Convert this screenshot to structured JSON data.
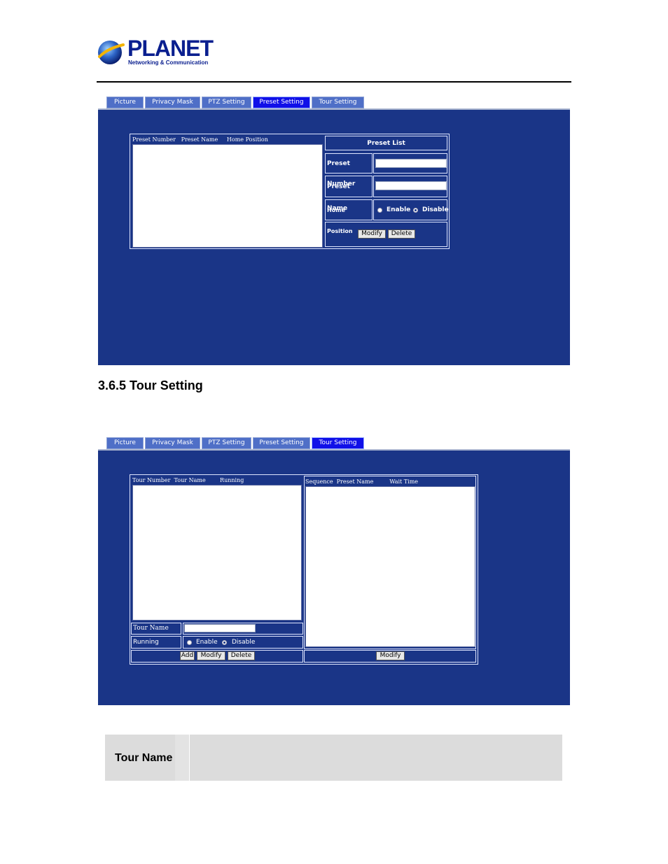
{
  "brand": {
    "name": "PLANET",
    "tagline": "Networking & Communication"
  },
  "tabs": [
    {
      "label": "Picture"
    },
    {
      "label": "Privacy Mask"
    },
    {
      "label": "PTZ Setting"
    },
    {
      "label": "Preset Setting"
    },
    {
      "label": "Tour Setting"
    }
  ],
  "preset_panel": {
    "active_tab": "Preset Setting",
    "list_header": "Preset Number   Preset Name     Home Position",
    "title": "Preset List",
    "preset_number_label": "Preset Number",
    "preset_number_value": "",
    "preset_name_label": "Preset Name",
    "preset_name_value": "",
    "home_position_label": "Home Position",
    "enable_label": "Enable",
    "disable_label": "Disable",
    "home_position_selected": "Disable",
    "modify_label": "Modify",
    "delete_label": "Delete"
  },
  "section_title": "3.6.5 Tour Setting",
  "tour_panel": {
    "active_tab": "Tour Setting",
    "tour_list_header": "Tour Number  Tour Name        Running",
    "sequence_list_header": "Sequence  Preset Name         Wait Time",
    "tour_name_label": "Tour Name",
    "tour_name_value": "",
    "running_label": "Running",
    "enable_label": "Enable",
    "disable_label": "Disable",
    "running_selected": "Disable",
    "add_label": "Add",
    "modify_label": "Modify",
    "delete_label": "Delete",
    "sequence_modify_label": "Modify"
  },
  "table": {
    "row_label": "Tour Name"
  },
  "colors": {
    "panel": "#1a3587",
    "tab": "#4f6fc7",
    "tab_active": "#1010e8",
    "brand": "#0a1f8f"
  }
}
